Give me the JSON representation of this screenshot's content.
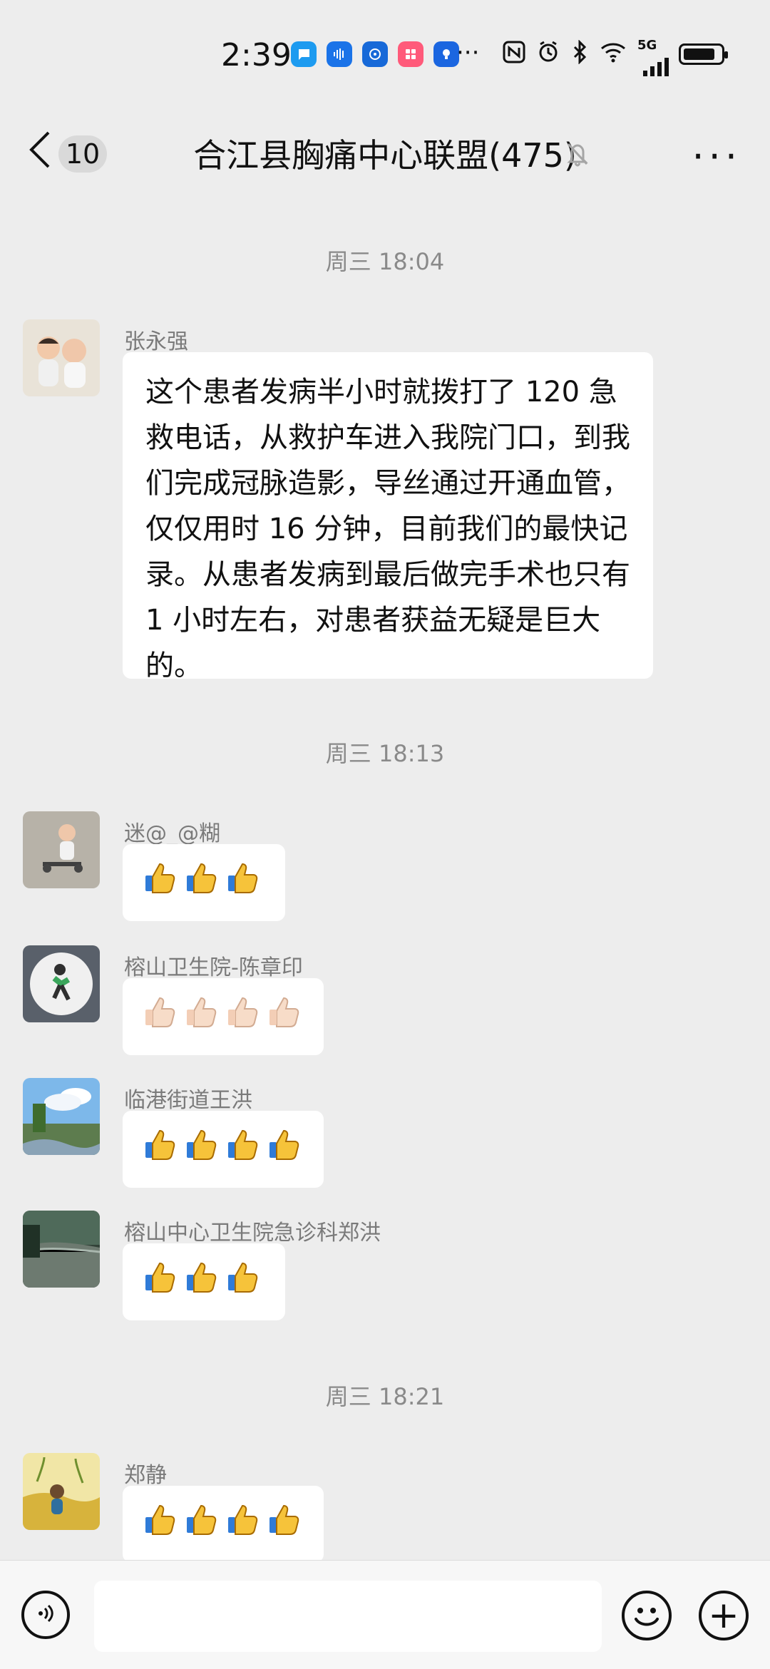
{
  "status_bar": {
    "time": "2:39",
    "more": "···",
    "network_label": "5G",
    "battery_percent": 90,
    "signal_bars": 4
  },
  "header": {
    "back_icon": "chevron-left-icon",
    "unread_count": "10",
    "title": "合江县胸痛中心联盟(475)",
    "mute_icon": "bell-off-icon",
    "more_icon": "more-horizontal-icon"
  },
  "messages": [
    {
      "type": "time",
      "text": "周三 18:04"
    },
    {
      "type": "text",
      "sender": "张永强",
      "avatar": "avatar-kids",
      "text": "这个患者发病半小时就拨打了 120 急救电话，从救护车进入我院门口，到我们完成冠脉造影，导丝通过开通血管，仅仅用时 16 分钟，目前我们的最快记录。从患者发病到最后做完手术也只有 1 小时左右，对患者获益无疑是巨大的。"
    },
    {
      "type": "time",
      "text": "周三 18:13"
    },
    {
      "type": "emoji",
      "sender": "迷@_@糊",
      "avatar": "avatar-child-scooter",
      "emoji": "thumbs-up-icon",
      "count": 3,
      "tone": "yellow"
    },
    {
      "type": "emoji",
      "sender": "榕山卫生院-陈章印",
      "avatar": "avatar-runner",
      "emoji": "thumbs-up-icon",
      "count": 4,
      "tone": "light"
    },
    {
      "type": "emoji",
      "sender": "临港街道王洪",
      "avatar": "avatar-sky-tree",
      "emoji": "thumbs-up-icon",
      "count": 4,
      "tone": "yellow"
    },
    {
      "type": "emoji",
      "sender": "榕山中心卫生院急诊科郑洪",
      "avatar": "avatar-river",
      "emoji": "thumbs-up-icon",
      "count": 3,
      "tone": "yellow"
    },
    {
      "type": "time",
      "text": "周三 18:21"
    },
    {
      "type": "emoji",
      "sender": "郑静",
      "avatar": "avatar-field",
      "emoji": "thumbs-up-icon",
      "count": 4,
      "tone": "yellow"
    }
  ],
  "input_bar": {
    "voice_icon": "voice-icon",
    "emoji_icon": "smile-icon",
    "plus_icon": "plus-icon",
    "input_value": ""
  }
}
